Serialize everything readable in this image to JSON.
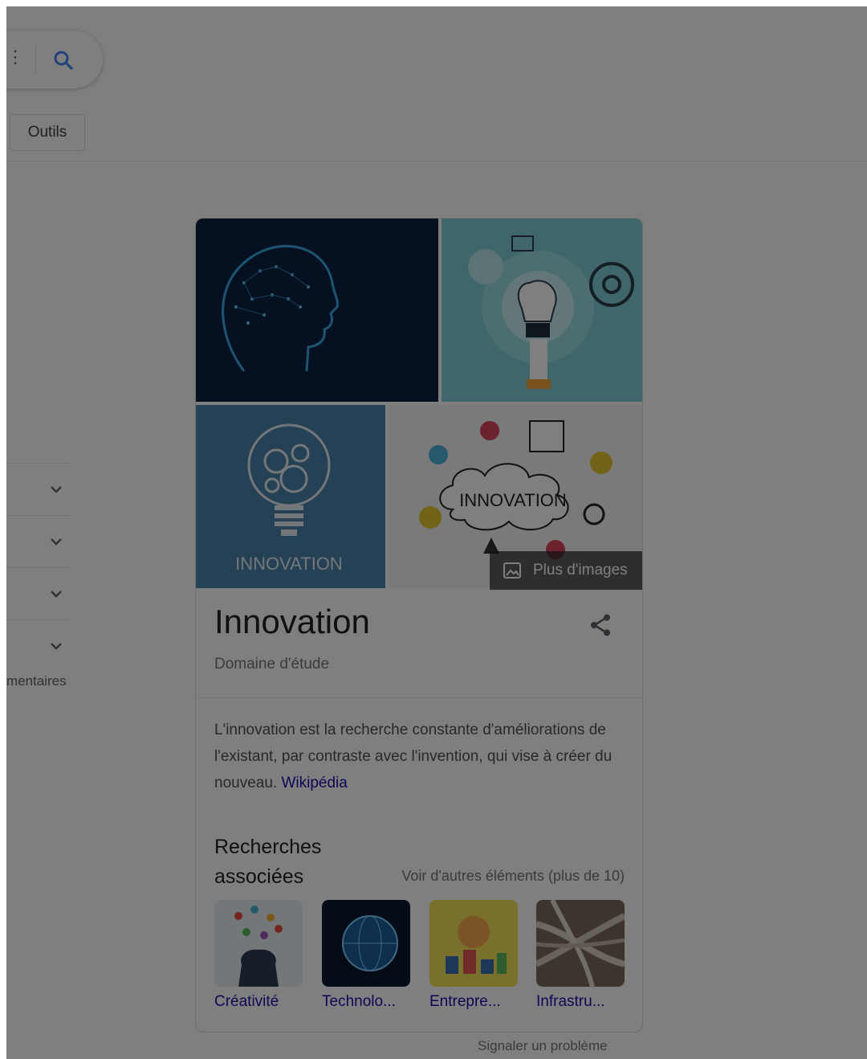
{
  "search": {
    "icon": "search-icon"
  },
  "toolbar": {
    "tools_label": "Outils"
  },
  "sidebar": {
    "truncated_label": "mentaires"
  },
  "knowledge_panel": {
    "more_images_label": "Plus d'images",
    "title": "Innovation",
    "subtitle": "Domaine d'étude",
    "description": "L'innovation est la recherche constante d'améliorations de l'existant, par contraste avec l'invention, qui vise à créer du nouveau. ",
    "source_link": "Wikipédia",
    "image_caption_text": "INNOVATION",
    "bulb_caption_text": "INNOVATION",
    "related": {
      "title": "Recherches associées",
      "more_label": "Voir d'autres éléments (plus de 10)",
      "items": [
        {
          "label": "Créativité"
        },
        {
          "label": "Technolo..."
        },
        {
          "label": "Entrepre..."
        },
        {
          "label": "Infrastru..."
        }
      ]
    }
  },
  "footer": {
    "report_label": "Signaler un problème"
  },
  "colors": {
    "link": "#1a0dab",
    "accent": "#1a73e8",
    "scrim": "rgba(0,0,0,0.5)"
  }
}
